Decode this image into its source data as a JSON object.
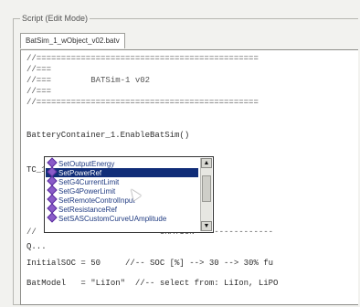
{
  "window": {
    "group_title": "Script (Edit Mode)",
    "tab_label": "BatSim_1_wObject_v02.batv"
  },
  "editor": {
    "lines": [
      "//=============================================",
      "//===",
      "//===        BATSim-1 v02",
      "//===",
      "//=============================================",
      "",
      "BatteryContainer_1.EnableBatSim()",
      "",
      "",
      "TC_1.",
      "",
      "",
      "",
      "//                         URATION ---------------",
      "Q...",
      "InitialSOC = 50     //-- SOC [%] --> 30 --> 30% fu",
      "BatModel   = \"LiIon\"  //-- select from: LiIon, LiPO"
    ]
  },
  "autocomplete": {
    "items": [
      "SetOutputEnergy",
      "SetPowerRef",
      "SetG4CurrentLimit",
      "SetG4PowerLimit",
      "SetRemoteControlInput",
      "SetResistanceRef",
      "SetSASCustomCurveUAmplitude"
    ],
    "selected_index": 1,
    "scroll_up": "▲",
    "scroll_down": "▼"
  }
}
